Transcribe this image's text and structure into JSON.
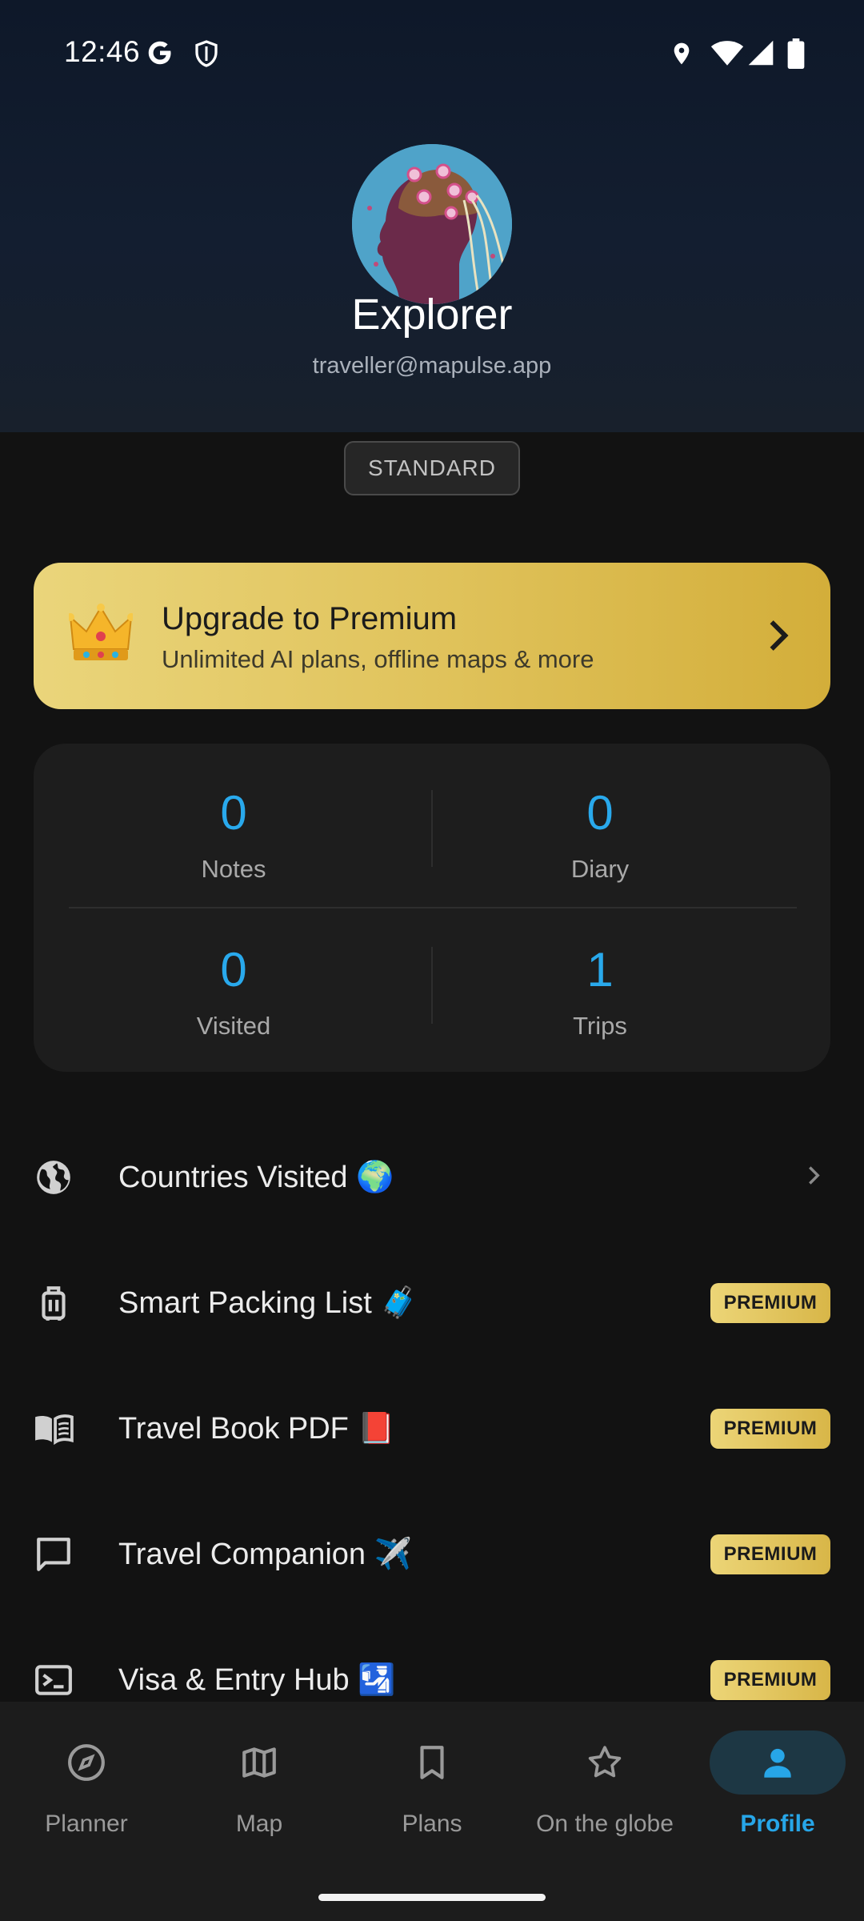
{
  "status_bar": {
    "time": "12:46",
    "left_icons": [
      "google-icon",
      "shield-icon"
    ],
    "right_icons": [
      "location-icon",
      "wifi-icon",
      "signal-icon",
      "battery-icon"
    ]
  },
  "profile": {
    "name": "Explorer",
    "email": "traveller@mapulse.app",
    "tier": "STANDARD"
  },
  "premium_banner": {
    "title": "Upgrade to Premium",
    "subtitle": "Unlimited AI plans, offline maps & more",
    "icon": "crown-icon"
  },
  "stats": [
    {
      "value": "0",
      "label": "Notes"
    },
    {
      "value": "0",
      "label": "Diary"
    },
    {
      "value": "0",
      "label": "Visited"
    },
    {
      "value": "1",
      "label": "Trips"
    }
  ],
  "menu": [
    {
      "label": "Countries Visited 🌍",
      "icon": "globe-icon",
      "trailing": "chevron"
    },
    {
      "label": "Smart Packing List 🧳",
      "icon": "luggage-icon",
      "badge": "PREMIUM"
    },
    {
      "label": "Travel Book PDF 📕",
      "icon": "book-icon",
      "badge": "PREMIUM"
    },
    {
      "label": "Travel Companion ✈️",
      "icon": "chat-icon",
      "badge": "PREMIUM"
    },
    {
      "label": "Visa & Entry Hub 🛂",
      "icon": "passport-icon",
      "badge": "PREMIUM"
    }
  ],
  "nav": [
    {
      "label": "Planner",
      "icon": "compass-icon"
    },
    {
      "label": "Map",
      "icon": "map-icon"
    },
    {
      "label": "Plans",
      "icon": "bookmark-icon"
    },
    {
      "label": "On the globe",
      "icon": "star-icon"
    },
    {
      "label": "Profile",
      "icon": "person-icon",
      "active": true
    }
  ],
  "colors": {
    "accent": "#29a9ec",
    "premium_gold": "#e0c35c",
    "background": "#121212"
  }
}
